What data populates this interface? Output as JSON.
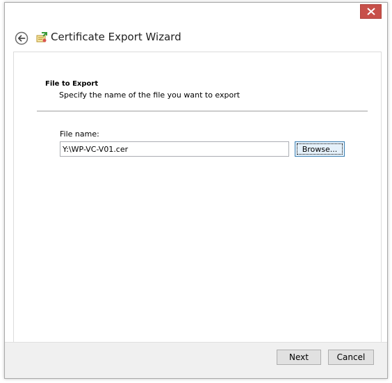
{
  "window": {
    "title": "Certificate Export Wizard",
    "close_icon": "close-icon",
    "back_icon": "back-arrow-icon",
    "wizard_icon": "certificate-icon",
    "close_color": "#c7504a"
  },
  "page": {
    "section_title": "File to Export",
    "section_subtitle": "Specify the name of the file you want to export"
  },
  "form": {
    "file_name_label": "File name:",
    "file_name_value": "Y:\\WP-VC-V01.cer",
    "browse_label": "Browse..."
  },
  "footer": {
    "next_label": "Next",
    "cancel_label": "Cancel"
  }
}
